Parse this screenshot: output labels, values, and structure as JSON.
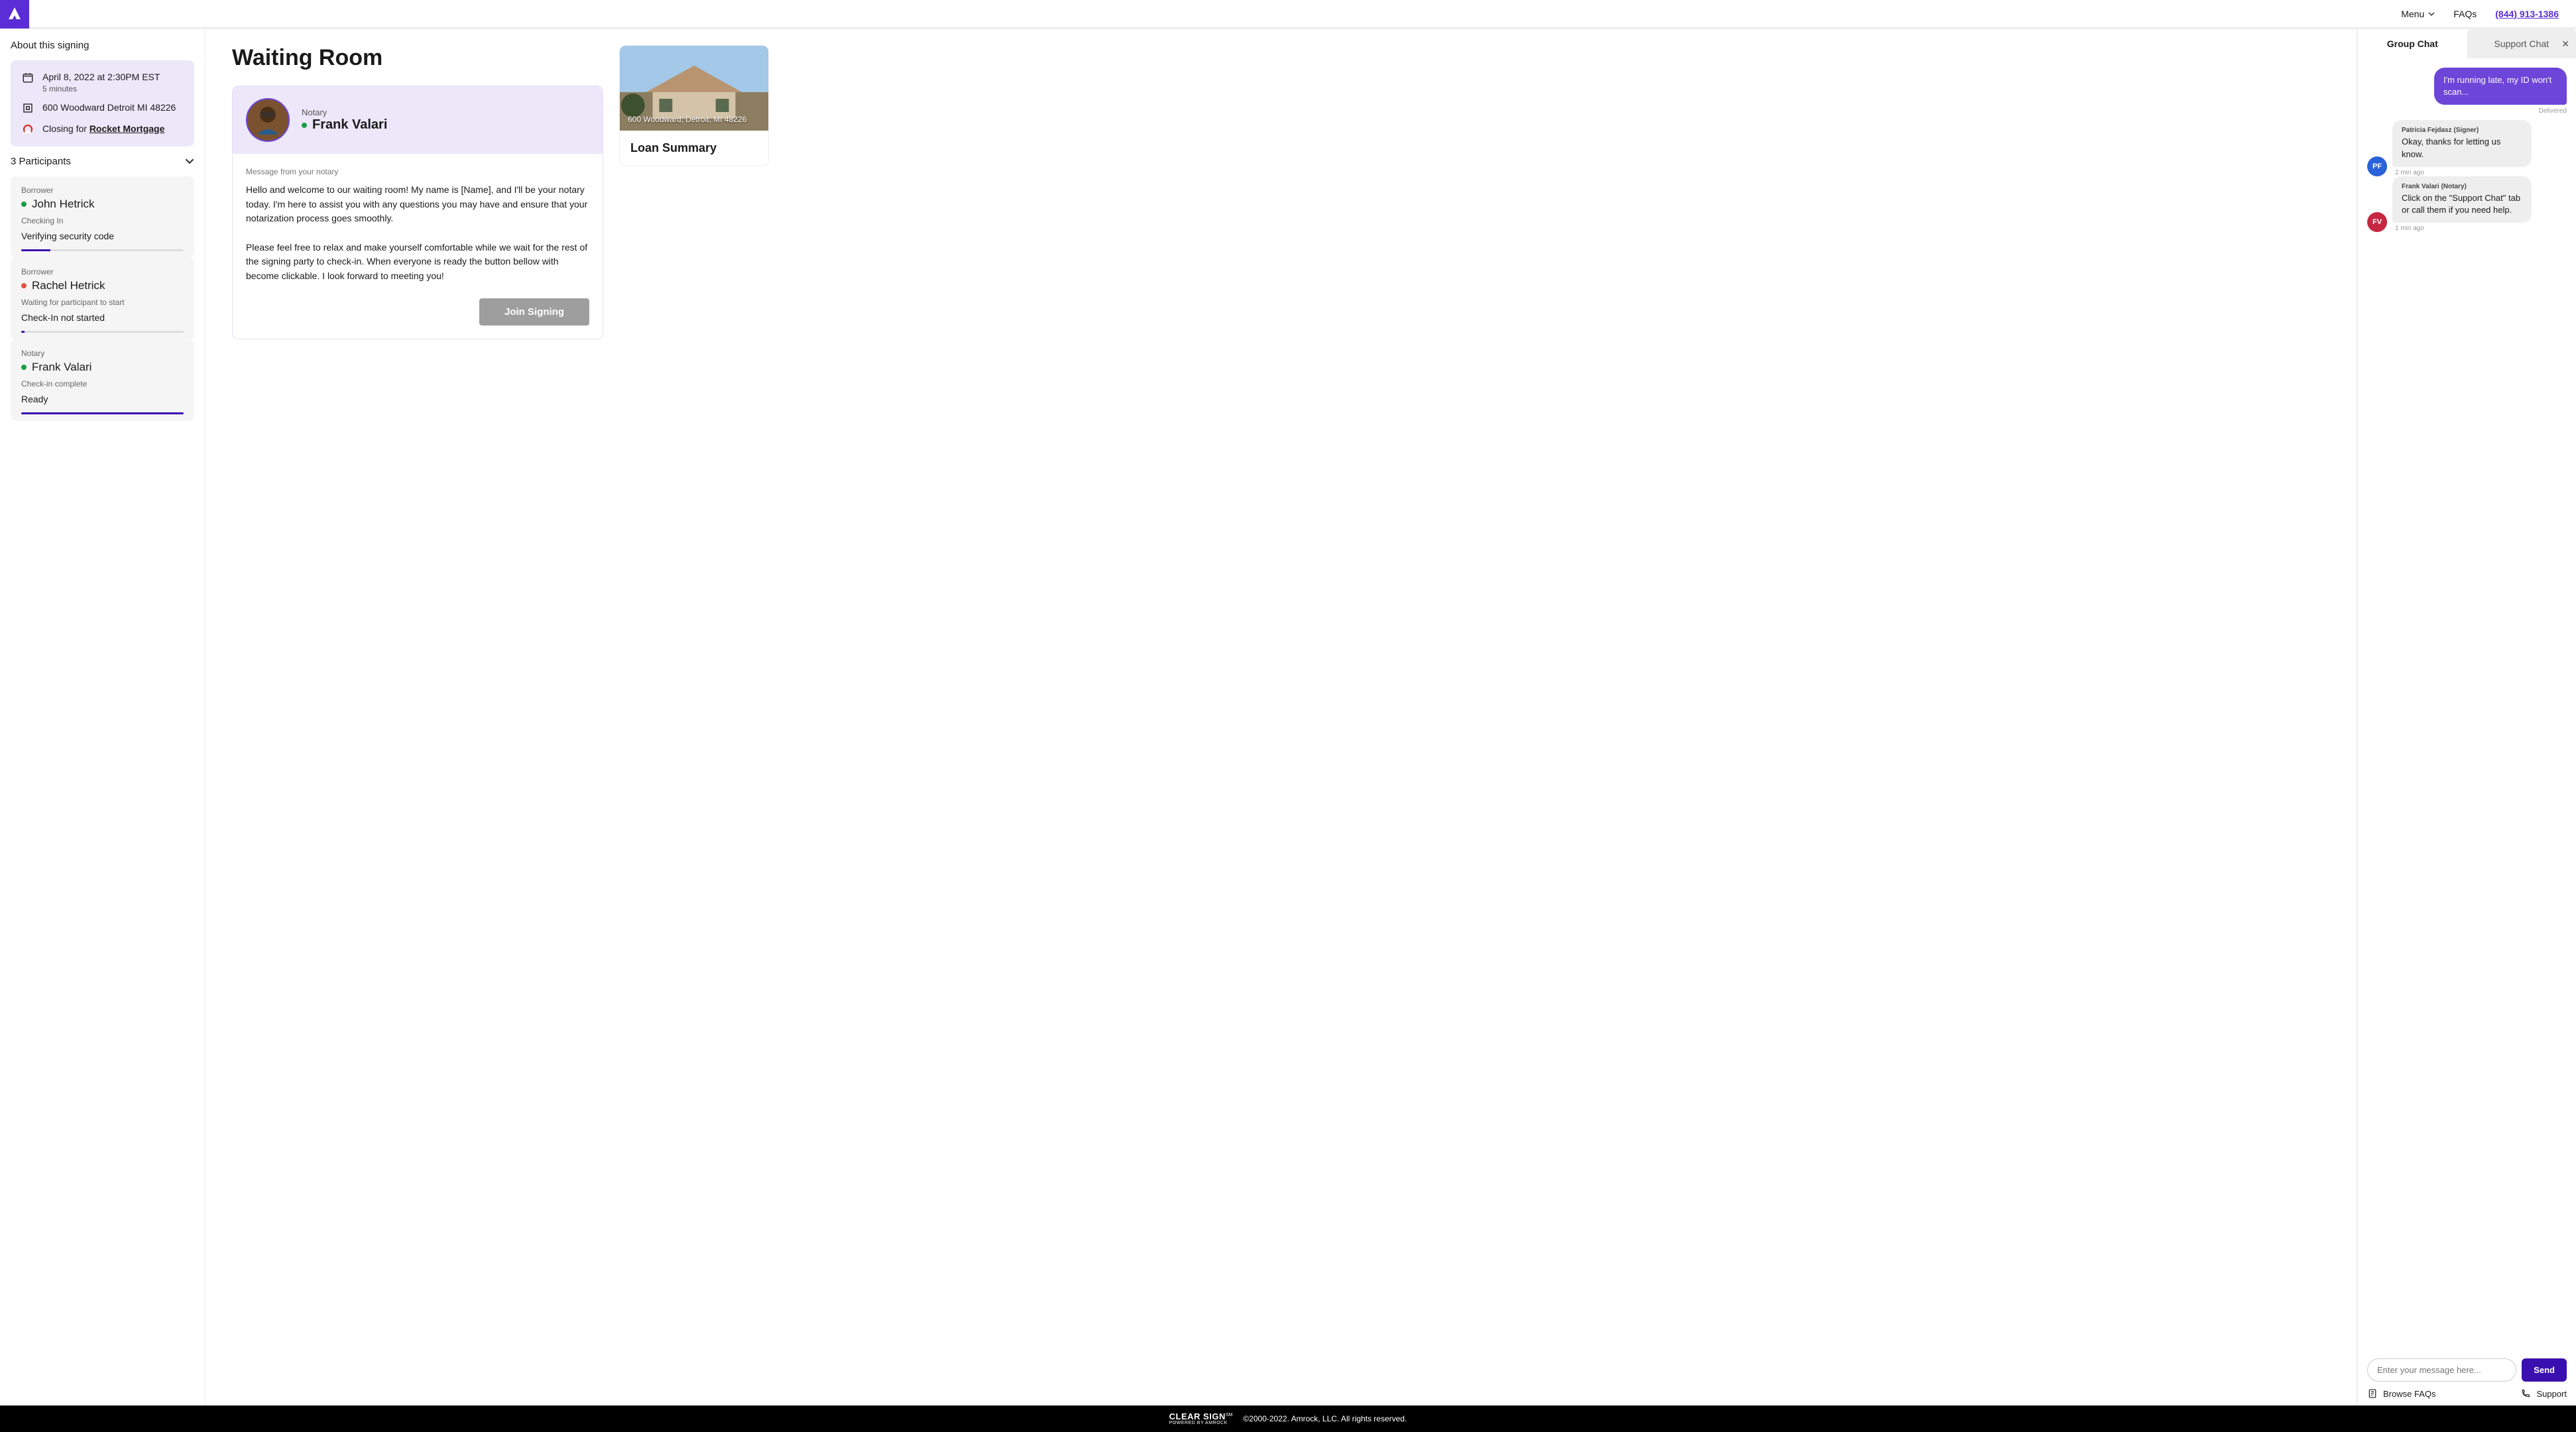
{
  "nav": {
    "menu": "Menu",
    "faqs": "FAQs",
    "phone": "(844) 913-1386"
  },
  "sidebar": {
    "title": "About this signing",
    "datetime": "April 8, 2022 at 2:30PM EST",
    "duration": "5 minutes",
    "address": "600 Woodward Detroit MI 48226",
    "closing_prefix": "Closing for ",
    "closing_lender": "Rocket Mortgage",
    "participants_header": "3 Participants",
    "participants": [
      {
        "role": "Borrower",
        "name": "John Hetrick",
        "dot": "green",
        "status_label": "Checking In",
        "status_text": "Verifying security code",
        "progress": 18
      },
      {
        "role": "Borrower",
        "name": "Rachel Hetrick",
        "dot": "orange",
        "status_label": "Waiting for participant to start",
        "status_text": "Check-In not started",
        "progress": 2
      },
      {
        "role": "Notary",
        "name": "Frank Valari",
        "dot": "green",
        "status_label": "Check-in complete",
        "status_text": "Ready",
        "progress": 100
      }
    ]
  },
  "main": {
    "page_title": "Waiting Room",
    "notary_role": "Notary",
    "notary_name": "Frank Valari",
    "msg_label": "Message from your notary",
    "msg_body": "Hello and welcome to our waiting room! My name is [Name], and I'll be your notary today. I'm here to assist you with any questions you may have and ensure that your notarization process goes smoothly.\n\nPlease feel free to relax and make yourself comfortable while we wait for the rest of the signing party to check-in. When everyone is ready the button bellow with become clickable. I look forward to meeting you!",
    "join_button": "Join Signing",
    "summary_address": "600 Woodward, Detroit, MI 48226",
    "summary_title": "Loan Summary"
  },
  "chat": {
    "tab_group": "Group Chat",
    "tab_support": "Support Chat",
    "outgoing": {
      "text": "I'm running late, my ID won't scan...",
      "status": "Delivered"
    },
    "incoming": [
      {
        "initials": "PF",
        "color": "blue",
        "sender": "Patricia Fejdasz (Signer)",
        "text": "Okay, thanks for letting us know.",
        "time": "2 min ago"
      },
      {
        "initials": "FV",
        "color": "red",
        "sender": "Frank Valari (Notary)",
        "text": "Click on the \"Support Chat\" tab or call them if you need help.",
        "time": "1 min ago"
      }
    ],
    "placeholder": "Enter your message here...",
    "send": "Send",
    "browse_faqs": "Browse FAQs",
    "support": "Support"
  },
  "footer": {
    "brand": "CLEAR SIGN",
    "brand_sm": "SM",
    "brand_sub": "POWERED BY AMROCK",
    "copyright": "©2000-2022. Amrock, LLC. All rights reserved."
  }
}
